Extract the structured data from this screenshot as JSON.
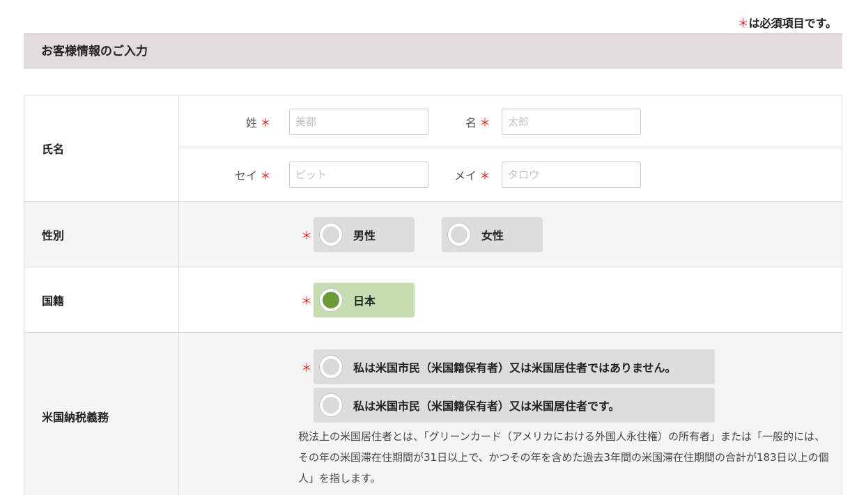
{
  "required_note": {
    "star": "＊",
    "text": "は必須項目です。"
  },
  "section": {
    "title": "お客様情報のご入力"
  },
  "name_row": {
    "label": "氏名",
    "sei_label": "姓",
    "sei_placeholder": "美都",
    "mei_label": "名",
    "mei_placeholder": "太郎",
    "sei_kana_label": "セイ",
    "sei_kana_placeholder": "ピット",
    "mei_kana_label": "メイ",
    "mei_kana_placeholder": "タロウ",
    "star": "＊"
  },
  "gender_row": {
    "label": "性別",
    "star": "＊",
    "options": [
      "男性",
      "女性"
    ],
    "selected": null
  },
  "nationality_row": {
    "label": "国籍",
    "star": "＊",
    "options": [
      "日本"
    ],
    "selected": "日本"
  },
  "tax_row": {
    "label": "米国納税義務",
    "star": "＊",
    "options": [
      "私は米国市民（米国籍保有者）又は米国居住者ではありません。",
      "私は米国市民（米国籍保有者）又は米国居住者です。"
    ],
    "note": "税法上の米国居住者とは、「グリーンカード（アメリカにおける外国人永住権）の所有者」または「一般的には、その年の米国滞在住期間が31日以上で、かつその年を含めた過去3年間の米国滞在住期間の合計が183日以上の個人」を指します。"
  },
  "colors": {
    "accent_required": "#d9262a",
    "header_bg": "#e3dbdd",
    "selected_bg": "#c5ddb0",
    "selected_dot": "#6b9a3a"
  }
}
